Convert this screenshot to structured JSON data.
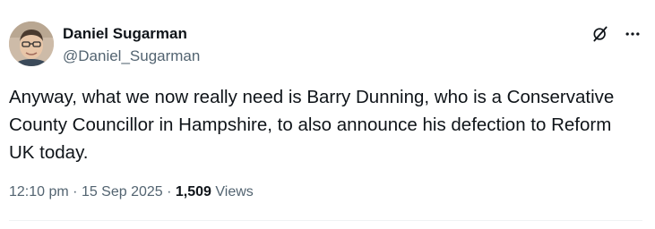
{
  "author": {
    "display_name": "Daniel Sugarman",
    "handle": "@Daniel_Sugarman",
    "avatar_icon": "user-photo"
  },
  "actions": {
    "grok_icon": "grok-icon",
    "more_icon": "more-dots-icon"
  },
  "tweet": {
    "text": "Anyway, what we now really need is Barry Dunning, who is a Conservative County Councillor in Hampshire, to also announce his defection to Reform UK today."
  },
  "meta": {
    "time": "12:10 pm",
    "sep1": " · ",
    "date": "15 Sep 2025",
    "sep2": " · ",
    "views_count": "1,509",
    "views_label": " Views"
  },
  "colors": {
    "primary_text": "#0f1419",
    "secondary_text": "#536471",
    "divider": "#eff3f4"
  }
}
